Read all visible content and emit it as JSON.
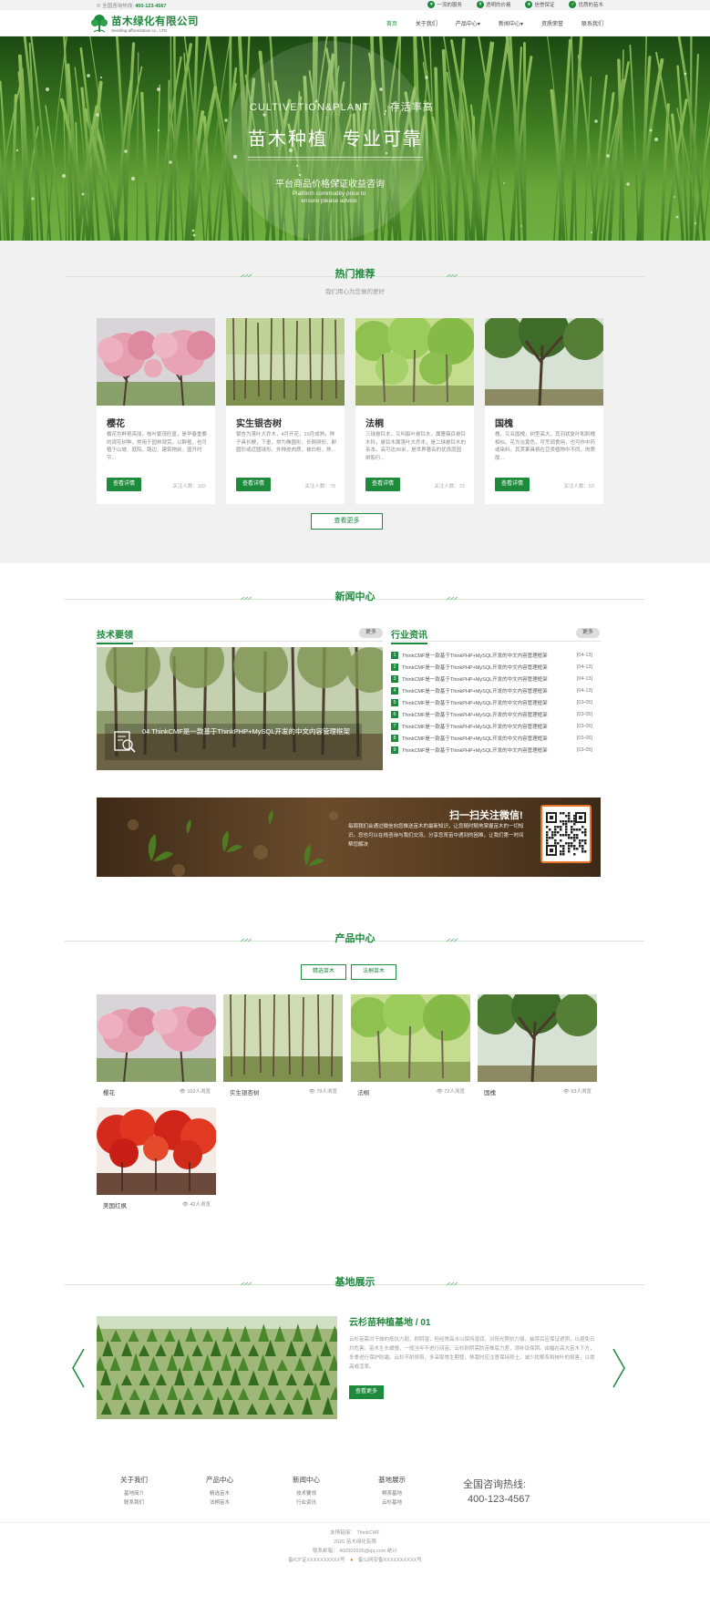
{
  "colors": {
    "brand": "#1d8a3c",
    "section_gray": "#f1f1f1"
  },
  "topbar": {
    "phone_label": "全国咨询热线:",
    "phone": "400-123-4567",
    "promises": [
      {
        "icon": "heart-icon",
        "label": "一流的服务"
      },
      {
        "icon": "shield-icon",
        "label": "透明的价格"
      },
      {
        "icon": "medal-icon",
        "label": "信誉保证"
      },
      {
        "icon": "shield-check-icon",
        "label": "优质的苗木"
      }
    ]
  },
  "header": {
    "logo_cn": "苗木绿化有限公司",
    "logo_en": "Seedling afforestation co., LTD",
    "nav": [
      "首页",
      "关于我们",
      "产品中心",
      "新闻中心",
      "资质荣誉",
      "联系我们"
    ],
    "nav_active": 0
  },
  "banner": {
    "line1_en": "CULTIVETION&PLANT",
    "line1_cn": "存活率高",
    "line2_a": "苗木种植",
    "line2_b": "专业可靠",
    "line3": "平台商品价格保证收益咨询",
    "line4": "Platform commodity price to ensure please advice"
  },
  "hot": {
    "title": "热门推荐",
    "subtitle": "我们用心为您做的更好",
    "button": "查看详情",
    "more": "查看更多",
    "items": [
      {
        "name": "樱花",
        "desc": "樱花色鲜艳亮丽，枝叶繁茂旺盛，是早春重要的观花树种，常用于园林观赏。以群植，也可植于山坡、庭院、路边、建筑物前。盛开时节...",
        "views": "关注人数：102"
      },
      {
        "name": "实生银杏树",
        "desc": "银杏为落叶大乔木，4月开花，10月成熟，种子具长梗，下垂，常为椭圆形、长倒卵形、卵圆形或近圆球形。外种皮肉质，被白粉，熟...",
        "views": "关注人数：79"
      },
      {
        "name": "法桐",
        "desc": "三球悬铃木，又叫裂叶悬铃木，属薔薇目悬铃木科，悬铃木属落叶大乔木，是二球悬铃木的亲本。高可达30米，是世界著名的优良庭园树和行...",
        "views": "关注人数：72"
      },
      {
        "name": "国槐",
        "desc": "槐，又名国槐，树型高大，其羽状复叶和刺槐相似。花为淡黄色，可烹调食用，也可作中药或染料。其荚果具柄在豆类植物中不同，肉质厚...",
        "views": "关注人数：53"
      }
    ]
  },
  "news": {
    "title": "新闻中心",
    "tech_title": "技术要领",
    "industry_title": "行业资讯",
    "more": "更多",
    "tech_caption": "04   ThinkCMF是一款基于ThinkPHP+MySQL开发的中文内容管理框架",
    "items": [
      {
        "text": "ThinkCMF是一款基于ThinkPHP+MySQL开发的中文内容管理框架",
        "date": "[04-13]"
      },
      {
        "text": "ThinkCMF是一款基于ThinkPHP+MySQL开发的中文内容管理框架",
        "date": "[04-13]"
      },
      {
        "text": "ThinkCMF是一款基于ThinkPHP+MySQL开发的中文内容管理框架",
        "date": "[04-13]"
      },
      {
        "text": "ThinkCMF是一款基于ThinkPHP+MySQL开发的中文内容管理框架",
        "date": "[04-13]"
      },
      {
        "text": "ThinkCMF是一款基于ThinkPHP+MySQL开发的中文内容管理框架",
        "date": "[03-05]"
      },
      {
        "text": "ThinkCMF是一款基于ThinkPHP+MySQL开发的中文内容管理框架",
        "date": "[03-05]"
      },
      {
        "text": "ThinkCMF是一款基于ThinkPHP+MySQL开发的中文内容管理框架",
        "date": "[03-05]"
      },
      {
        "text": "ThinkCMF是一款基于ThinkPHP+MySQL开发的中文内容管理框架",
        "date": "[03-05]"
      },
      {
        "text": "ThinkCMF是一款基于ThinkPHP+MySQL开发的中文内容管理框架",
        "date": "[03-05]"
      }
    ]
  },
  "wechat": {
    "title": "扫一扫关注微信!",
    "text": "每周我们会通过微信向您推送苗木的最新知识，让您随时随地掌握苗木的一切知识。您也可以在线咨询与我们交流，分享您育苗中遇到的困难，让我们第一时间帮您解决"
  },
  "products": {
    "title": "产品中心",
    "tabs": [
      "精选苗木",
      "法桐苗木"
    ],
    "items": [
      {
        "name": "樱花",
        "views": "102人浏览"
      },
      {
        "name": "实生银杏树",
        "views": "79人浏览"
      },
      {
        "name": "法桐",
        "views": "72人浏览"
      },
      {
        "name": "国槐",
        "views": "53人浏览"
      },
      {
        "name": "美国红枫",
        "views": "42人浏览"
      }
    ]
  },
  "base": {
    "title": "基地展示",
    "item_title": "云杉苗种植基地 / 01",
    "desc": "云杉苗需对干燥的抵抗力弱，耐阴湿，但经常高水以保持湿润，对阳光照抗力弱，抽芽后应保证遮阴，以避免日灼危害。苗木生长缓慢，一般当年不进行间苗。云杉耐阴需防苗株底力差，须补设保阴。由幅在高大苗木下方，冬季进行保护防霜。云杉不耐修剪，多采取常生期管，移栽时应注意保持原土。减少扰根系和枝叶的损害，以提高成活率。",
    "button": "查看更多"
  },
  "footer": {
    "cols": [
      {
        "title": "关于我们",
        "links": [
          "基地简介",
          "联系我们"
        ]
      },
      {
        "title": "产品中心",
        "links": [
          "精选苗木",
          "法桐苗木"
        ]
      },
      {
        "title": "新闻中心",
        "links": [
          "技术要领",
          "行业资讯"
        ]
      },
      {
        "title": "基地展示",
        "links": [
          "桐茶基地",
          "云杉基地"
        ]
      }
    ],
    "hotline_label": "全国咨询热线:",
    "hotline": "400-123-4567",
    "links_line": "友情链接：  ThinkCMF",
    "copyright": "2020 苗木绿化有限",
    "email": "联系邮箱：  400502926@qq.com  统计",
    "icp": "备ICP证XXXXXXXXXX号",
    "police": "备公网安备XXXXXXXXXX号"
  }
}
